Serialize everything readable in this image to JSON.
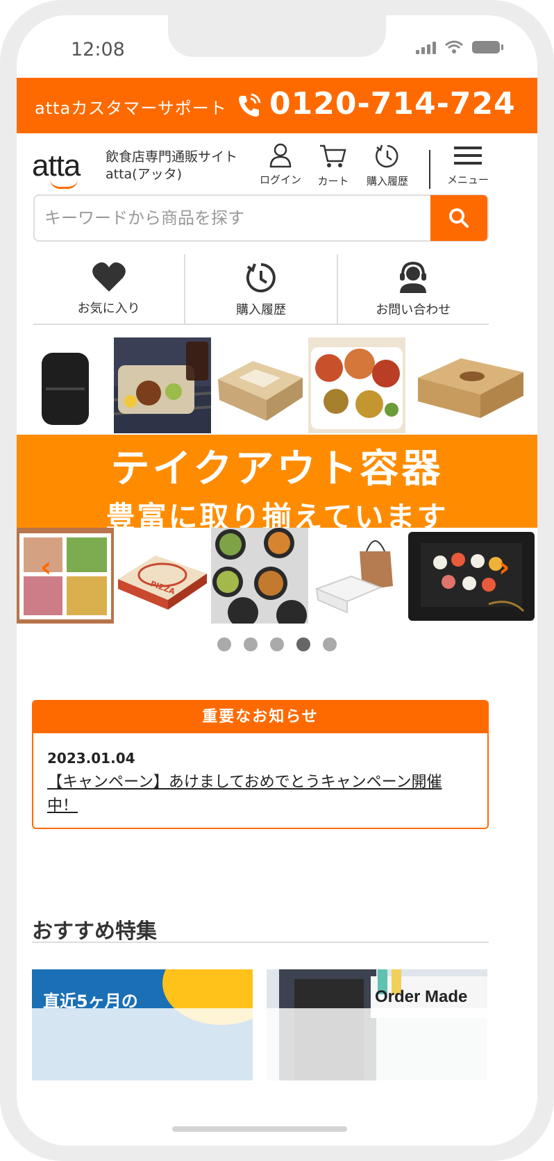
{
  "status": {
    "time": "12:08"
  },
  "support": {
    "label": "attaカスタマーサポート",
    "phone": "0120-714-724"
  },
  "header": {
    "logo": "atta",
    "site_desc_line1": "飲食店専門通販サイト",
    "site_desc_line2": "atta(アッタ)",
    "buttons": [
      {
        "label": "ログイン",
        "icon": "user-icon"
      },
      {
        "label": "カート",
        "icon": "cart-icon"
      },
      {
        "label": "購入履歴",
        "icon": "history-icon"
      },
      {
        "label": "メニュー",
        "icon": "hamburger-icon"
      }
    ]
  },
  "search": {
    "placeholder": "キーワードから商品を探す"
  },
  "quick_nav": [
    {
      "label": "お気に入り",
      "icon": "heart-icon"
    },
    {
      "label": "購入履歴",
      "icon": "history-icon"
    },
    {
      "label": "お問い合わせ",
      "icon": "support-agent-icon"
    }
  ],
  "banner": {
    "line1": "テイクアウト容器",
    "line2": "豊富に取り揃えています",
    "tile_labels": {
      "pizza": "PIZZA"
    },
    "slide_count": 5,
    "active_slide": 4
  },
  "notice": {
    "title": "重要なお知らせ",
    "date": "2023.01.04",
    "text": "【キャンペーン】あけましておめでとうキャンペーン開催中！"
  },
  "features": {
    "title": "おすすめ特集",
    "items": [
      {
        "text": "直近5ヶ月の"
      },
      {
        "text": "Order Made"
      }
    ]
  },
  "colors": {
    "accent": "#ff6a00",
    "banner": "#ff8c00"
  }
}
